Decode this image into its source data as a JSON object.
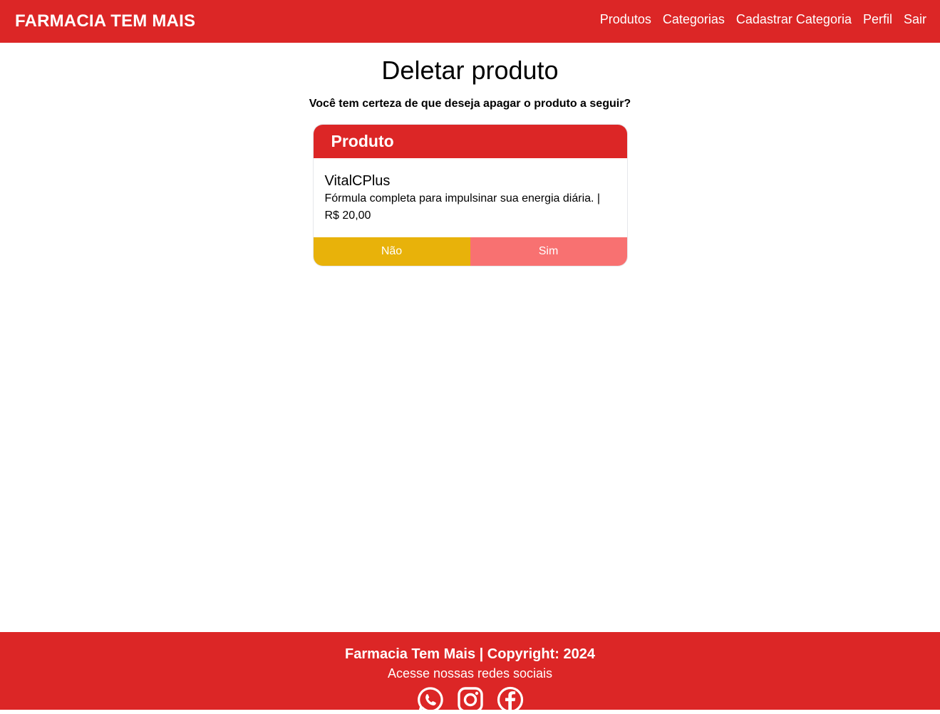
{
  "navbar": {
    "brand": "FARMACIA TEM MAIS",
    "links": [
      "Produtos",
      "Categorias",
      "Cadastrar Categoria",
      "Perfil",
      "Sair"
    ]
  },
  "page": {
    "title": "Deletar produto",
    "confirm_text": "Você tem certeza de que deseja apagar o produto a seguir?"
  },
  "card": {
    "header": "Produto",
    "product_name": "VitalCPlus",
    "product_desc": "Fórmula completa para impulsinar sua energia diária. | R$ 20,00",
    "no_label": "Não",
    "yes_label": "Sim"
  },
  "footer": {
    "copyright": "Farmacia Tem Mais | Copyright: 2024",
    "social_text": "Acesse nossas redes sociais",
    "icons": [
      "whatsapp-icon",
      "instagram-icon",
      "facebook-icon"
    ]
  },
  "colors": {
    "primary": "#dc2626",
    "no_button": "#e8b20a",
    "yes_button": "#f87171"
  }
}
